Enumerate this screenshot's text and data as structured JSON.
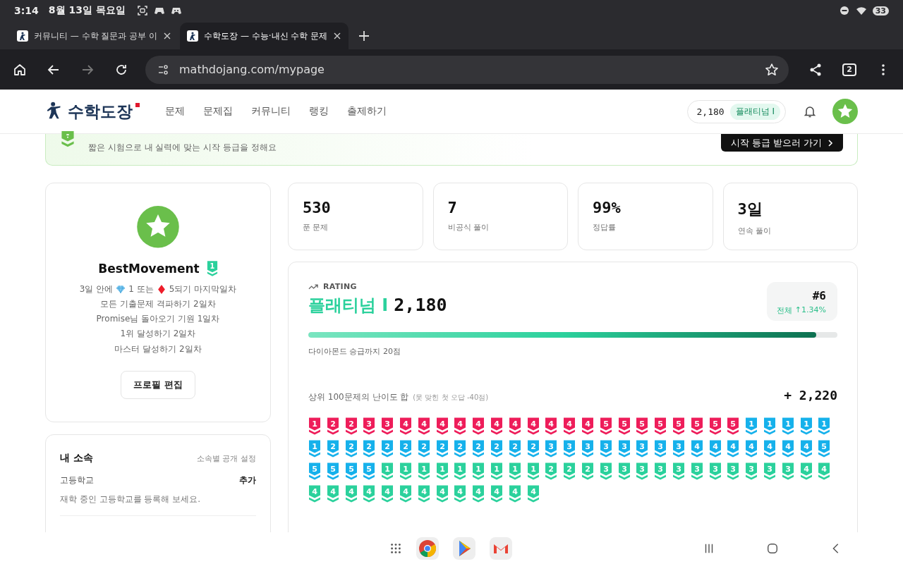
{
  "status_bar": {
    "time": "3:14",
    "date": "8월 13일 목요일",
    "battery": "33"
  },
  "browser": {
    "tabs": [
      {
        "title": "커뮤니티 — 수학 질문과 공부 이",
        "selected": false
      },
      {
        "title": "수학도장 — 수능·내신 수학 문제",
        "selected": true
      }
    ],
    "url": "mathdojang.com/mypage",
    "tab_count": "2"
  },
  "header": {
    "logo": "수학도장",
    "nav": [
      "문제",
      "문제집",
      "커뮤니티",
      "랭킹",
      "출제하기"
    ],
    "rating": "2,180",
    "tier": "플래티넘 I"
  },
  "banner": {
    "subtitle": "짧은 시험으로 내 실력에 맞는 시작 등급을 정해요",
    "button": "시작 등급 받으러 가기"
  },
  "profile": {
    "name": "BestMovement",
    "tier_level": "1",
    "streaks": [
      {
        "kind": "goal",
        "segments": [
          "3일 안에",
          "1 또는",
          "5되기 마지막일차"
        ]
      },
      {
        "kind": "text",
        "text": "모든 기출문제 격파하기 2일차"
      },
      {
        "kind": "text",
        "text": "Promise님 돌아오기 기원 1일차"
      },
      {
        "kind": "text",
        "text": "1위 달성하기 2일차"
      },
      {
        "kind": "text",
        "text": "마스터 달성하기 2일차"
      }
    ],
    "edit_button": "프로필 편집"
  },
  "affiliation": {
    "title": "내 소속",
    "setting": "소속별 공개 설정",
    "rows": [
      {
        "label": "고등학교",
        "action": "추가",
        "hint": "재학 중인 고등학교를 등록해 보세요."
      }
    ]
  },
  "stats": [
    {
      "value": "530",
      "label": "푼 문제"
    },
    {
      "value": "7",
      "label": "비공식 풀이"
    },
    {
      "value": "99%",
      "label": "정답률"
    },
    {
      "value": "3일",
      "label": "연속 풀이"
    }
  ],
  "rating": {
    "heading": "RATING",
    "tier": "플래티넘 I",
    "score": "2,180",
    "rank": "#6",
    "scope": "전체",
    "change": "↑1.34%",
    "level": 0.96,
    "next": "다이아몬드 승급까지 20점",
    "sum_label": "상위 100문제의 난이도 합",
    "sum_note": "(못 맞힌 첫 오답 -40점)",
    "sum": "+ 2,220",
    "problems": [
      {
        "grade": "1",
        "color": "#ee1d5a"
      },
      {
        "grade": "2",
        "color": "#ee1d5a"
      },
      {
        "grade": "2",
        "color": "#ee1d5a"
      },
      {
        "grade": "3",
        "color": "#ee1d5a"
      },
      {
        "grade": "3",
        "color": "#ee1d5a"
      },
      {
        "grade": "4",
        "color": "#ee1d5a"
      },
      {
        "grade": "4",
        "color": "#ee1d5a"
      },
      {
        "grade": "4",
        "color": "#ee1d5a"
      },
      {
        "grade": "4",
        "color": "#ee1d5a"
      },
      {
        "grade": "4",
        "color": "#ee1d5a"
      },
      {
        "grade": "4",
        "color": "#ee1d5a"
      },
      {
        "grade": "4",
        "color": "#ee1d5a"
      },
      {
        "grade": "4",
        "color": "#ee1d5a"
      },
      {
        "grade": "4",
        "color": "#ee1d5a"
      },
      {
        "grade": "4",
        "color": "#ee1d5a"
      },
      {
        "grade": "4",
        "color": "#ee1d5a"
      },
      {
        "grade": "5",
        "color": "#ee1d5a"
      },
      {
        "grade": "5",
        "color": "#ee1d5a"
      },
      {
        "grade": "5",
        "color": "#ee1d5a"
      },
      {
        "grade": "5",
        "color": "#ee1d5a"
      },
      {
        "grade": "5",
        "color": "#ee1d5a"
      },
      {
        "grade": "5",
        "color": "#ee1d5a"
      },
      {
        "grade": "5",
        "color": "#ee1d5a"
      },
      {
        "grade": "5",
        "color": "#ee1d5a"
      },
      {
        "grade": "1",
        "color": "#16b1eb"
      },
      {
        "grade": "1",
        "color": "#16b1eb"
      },
      {
        "grade": "1",
        "color": "#16b1eb"
      },
      {
        "grade": "1",
        "color": "#16b1eb"
      },
      {
        "grade": "1",
        "color": "#16b1eb"
      },
      {
        "grade": "1",
        "color": "#16b1eb"
      },
      {
        "grade": "2",
        "color": "#16b1eb"
      },
      {
        "grade": "2",
        "color": "#16b1eb"
      },
      {
        "grade": "2",
        "color": "#16b1eb"
      },
      {
        "grade": "2",
        "color": "#16b1eb"
      },
      {
        "grade": "2",
        "color": "#16b1eb"
      },
      {
        "grade": "2",
        "color": "#16b1eb"
      },
      {
        "grade": "2",
        "color": "#16b1eb"
      },
      {
        "grade": "2",
        "color": "#16b1eb"
      },
      {
        "grade": "2",
        "color": "#16b1eb"
      },
      {
        "grade": "2",
        "color": "#16b1eb"
      },
      {
        "grade": "2",
        "color": "#16b1eb"
      },
      {
        "grade": "2",
        "color": "#16b1eb"
      },
      {
        "grade": "3",
        "color": "#16b1eb"
      },
      {
        "grade": "3",
        "color": "#16b1eb"
      },
      {
        "grade": "3",
        "color": "#16b1eb"
      },
      {
        "grade": "3",
        "color": "#16b1eb"
      },
      {
        "grade": "3",
        "color": "#16b1eb"
      },
      {
        "grade": "3",
        "color": "#16b1eb"
      },
      {
        "grade": "3",
        "color": "#16b1eb"
      },
      {
        "grade": "3",
        "color": "#16b1eb"
      },
      {
        "grade": "4",
        "color": "#16b1eb"
      },
      {
        "grade": "4",
        "color": "#16b1eb"
      },
      {
        "grade": "4",
        "color": "#16b1eb"
      },
      {
        "grade": "4",
        "color": "#16b1eb"
      },
      {
        "grade": "4",
        "color": "#16b1eb"
      },
      {
        "grade": "4",
        "color": "#16b1eb"
      },
      {
        "grade": "4",
        "color": "#16b1eb"
      },
      {
        "grade": "5",
        "color": "#16b1eb"
      },
      {
        "grade": "5",
        "color": "#16b1eb"
      },
      {
        "grade": "5",
        "color": "#16b1eb"
      },
      {
        "grade": "5",
        "color": "#16b1eb"
      },
      {
        "grade": "5",
        "color": "#16b1eb"
      },
      {
        "grade": "1",
        "color": "#2bd19c"
      },
      {
        "grade": "1",
        "color": "#2bd19c"
      },
      {
        "grade": "1",
        "color": "#2bd19c"
      },
      {
        "grade": "1",
        "color": "#2bd19c"
      },
      {
        "grade": "1",
        "color": "#2bd19c"
      },
      {
        "grade": "1",
        "color": "#2bd19c"
      },
      {
        "grade": "1",
        "color": "#2bd19c"
      },
      {
        "grade": "1",
        "color": "#2bd19c"
      },
      {
        "grade": "1",
        "color": "#2bd19c"
      },
      {
        "grade": "2",
        "color": "#2bd19c"
      },
      {
        "grade": "2",
        "color": "#2bd19c"
      },
      {
        "grade": "2",
        "color": "#2bd19c"
      },
      {
        "grade": "3",
        "color": "#2bd19c"
      },
      {
        "grade": "3",
        "color": "#2bd19c"
      },
      {
        "grade": "3",
        "color": "#2bd19c"
      },
      {
        "grade": "3",
        "color": "#2bd19c"
      },
      {
        "grade": "3",
        "color": "#2bd19c"
      },
      {
        "grade": "3",
        "color": "#2bd19c"
      },
      {
        "grade": "3",
        "color": "#2bd19c"
      },
      {
        "grade": "3",
        "color": "#2bd19c"
      },
      {
        "grade": "3",
        "color": "#2bd19c"
      },
      {
        "grade": "3",
        "color": "#2bd19c"
      },
      {
        "grade": "3",
        "color": "#2bd19c"
      },
      {
        "grade": "4",
        "color": "#2bd19c"
      },
      {
        "grade": "4",
        "color": "#2bd19c"
      },
      {
        "grade": "4",
        "color": "#2bd19c"
      },
      {
        "grade": "4",
        "color": "#2bd19c"
      },
      {
        "grade": "4",
        "color": "#2bd19c"
      },
      {
        "grade": "4",
        "color": "#2bd19c"
      },
      {
        "grade": "4",
        "color": "#2bd19c"
      },
      {
        "grade": "4",
        "color": "#2bd19c"
      },
      {
        "grade": "4",
        "color": "#2bd19c"
      },
      {
        "grade": "4",
        "color": "#2bd19c"
      },
      {
        "grade": "4",
        "color": "#2bd19c"
      },
      {
        "grade": "4",
        "color": "#2bd19c"
      },
      {
        "grade": "4",
        "color": "#2bd19c"
      },
      {
        "grade": "4",
        "color": "#2bd19c"
      },
      {
        "grade": "4",
        "color": "#2bd19c"
      }
    ]
  }
}
